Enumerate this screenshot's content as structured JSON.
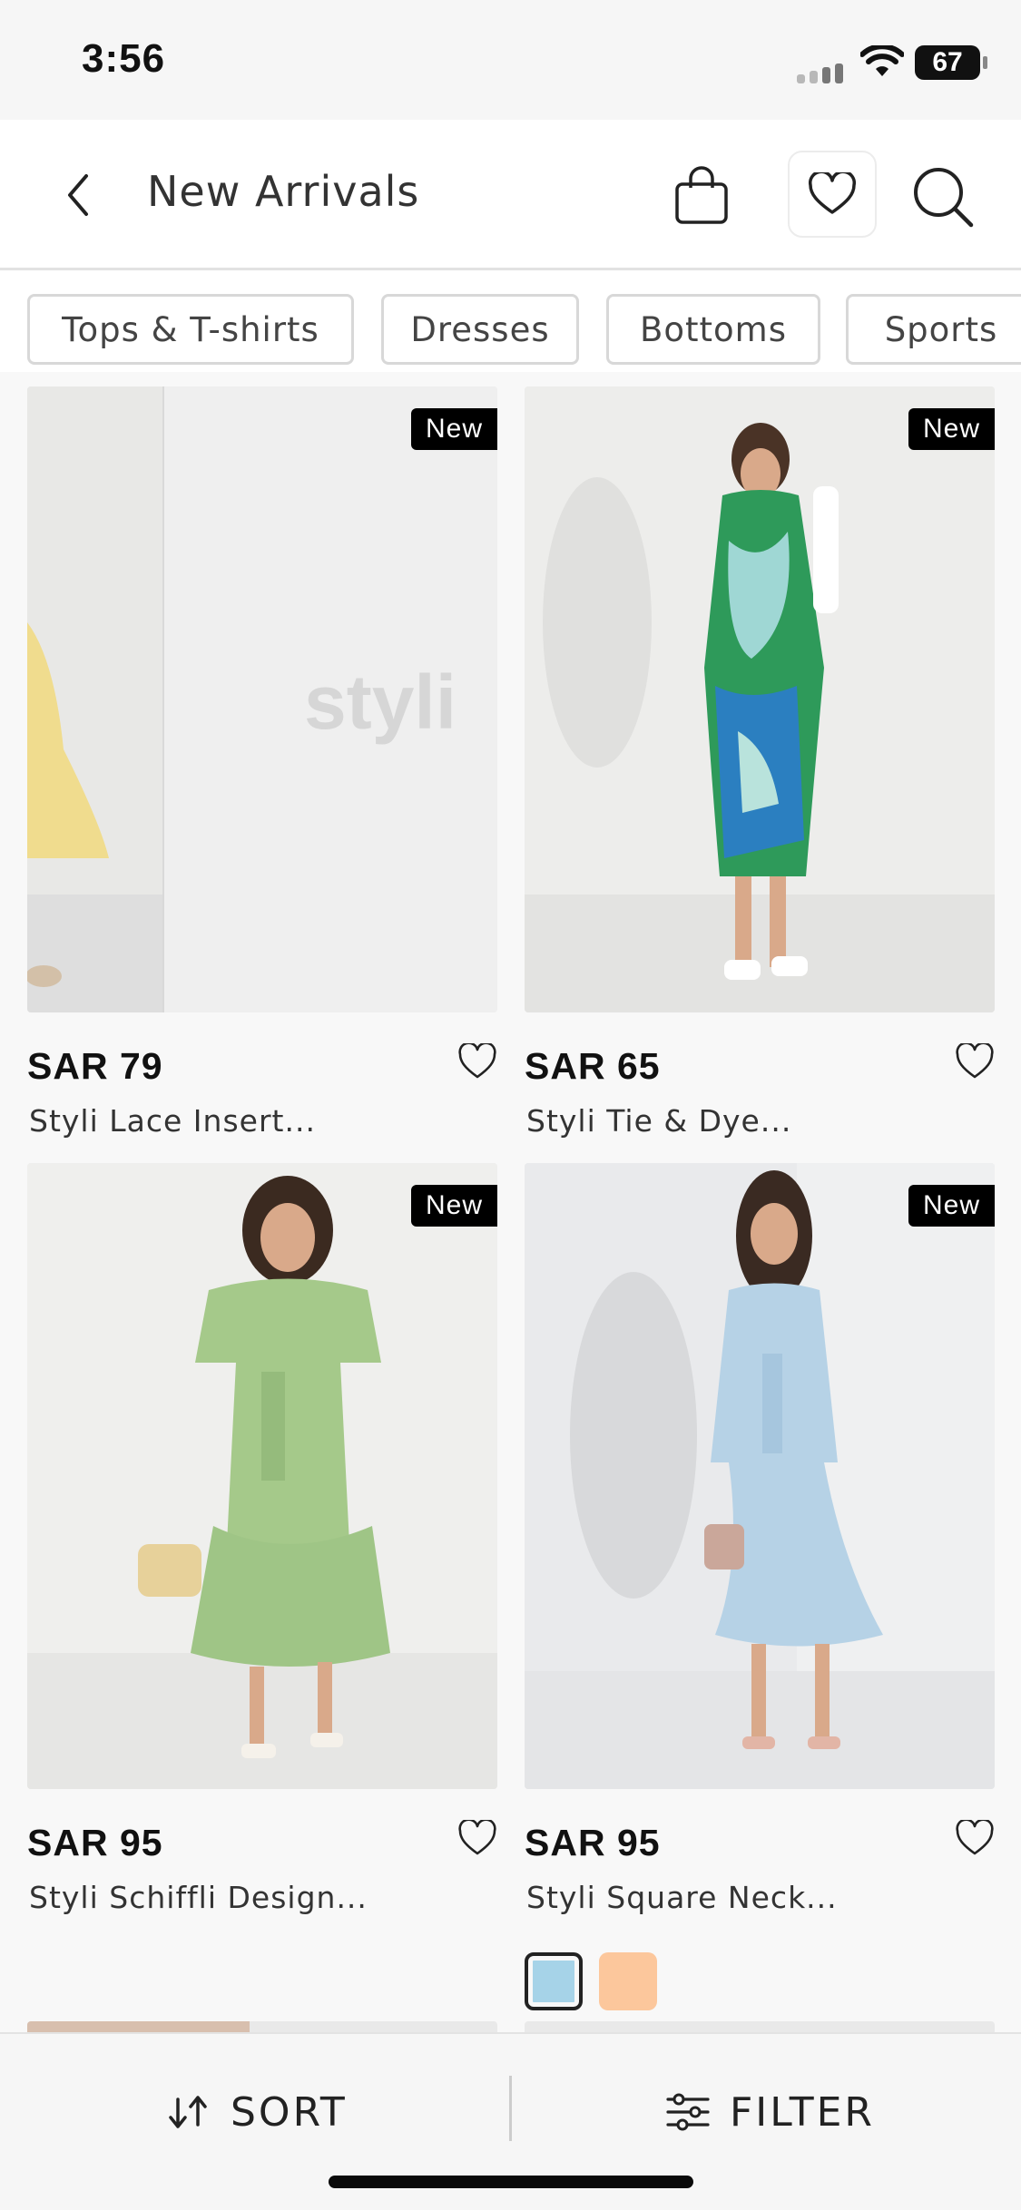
{
  "status_bar": {
    "time": "3:56",
    "battery": "67"
  },
  "header": {
    "title": "New Arrivals"
  },
  "categories": [
    "Tops & T-shirts",
    "Dresses",
    "Bottoms",
    "Sports"
  ],
  "products": [
    {
      "badge": "New",
      "price": "SAR 79",
      "brand": "Styli",
      "name": "Lace Insert...",
      "watermark": "styli"
    },
    {
      "badge": "New",
      "price": "SAR 65",
      "brand": "Styli",
      "name": "Tie & Dye..."
    },
    {
      "badge": "New",
      "price": "SAR 95",
      "brand": "Styli",
      "name": "Schiffli Design..."
    },
    {
      "badge": "New",
      "price": "SAR 95",
      "brand": "Styli",
      "name": "Square Neck...",
      "swatches": [
        "#a6d3e8",
        "#fcc79c"
      ]
    }
  ],
  "footer": {
    "sort_label": "SORT",
    "filter_label": "FILTER"
  }
}
